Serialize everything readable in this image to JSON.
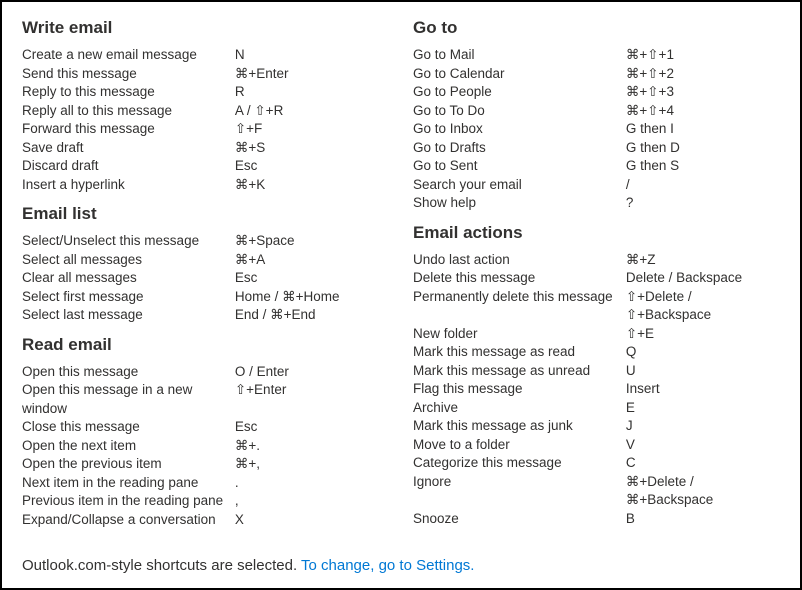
{
  "left": [
    {
      "title": "Write email",
      "rows": [
        {
          "desc": "Create a new email message",
          "key": "N"
        },
        {
          "desc": "Send this message",
          "key": "⌘+Enter"
        },
        {
          "desc": "Reply to this message",
          "key": "R"
        },
        {
          "desc": "Reply all to this message",
          "key": "A / ⇧+R"
        },
        {
          "desc": "Forward this message",
          "key": "⇧+F"
        },
        {
          "desc": "Save draft",
          "key": "⌘+S"
        },
        {
          "desc": "Discard draft",
          "key": "Esc"
        },
        {
          "desc": "Insert a hyperlink",
          "key": "⌘+K"
        }
      ]
    },
    {
      "title": "Email list",
      "rows": [
        {
          "desc": "Select/Unselect this message",
          "key": "⌘+Space"
        },
        {
          "desc": "Select all messages",
          "key": "⌘+A"
        },
        {
          "desc": "Clear all messages",
          "key": "Esc"
        },
        {
          "desc": "Select first message",
          "key": "Home / ⌘+Home"
        },
        {
          "desc": "Select last message",
          "key": "End / ⌘+End"
        }
      ]
    },
    {
      "title": "Read email",
      "rows": [
        {
          "desc": "Open this message",
          "key": "O / Enter"
        },
        {
          "desc": "Open this message in a new window",
          "key": "⇧+Enter"
        },
        {
          "desc": "Close this message",
          "key": "Esc"
        },
        {
          "desc": "Open the next item",
          "key": "⌘+."
        },
        {
          "desc": "Open the previous item",
          "key": "⌘+,"
        },
        {
          "desc": "Next item in the reading pane",
          "key": "."
        },
        {
          "desc": "Previous item in the reading pane",
          "key": ","
        },
        {
          "desc": "Expand/Collapse a conversation",
          "key": "X"
        }
      ]
    }
  ],
  "right": [
    {
      "title": "Go to",
      "rows": [
        {
          "desc": "Go to Mail",
          "key": "⌘+⇧+1"
        },
        {
          "desc": "Go to Calendar",
          "key": "⌘+⇧+2"
        },
        {
          "desc": "Go to People",
          "key": "⌘+⇧+3"
        },
        {
          "desc": "Go to To Do",
          "key": "⌘+⇧+4"
        },
        {
          "desc": "Go to Inbox",
          "key": "G then I"
        },
        {
          "desc": "Go to Drafts",
          "key": "G then D"
        },
        {
          "desc": "Go to Sent",
          "key": "G then S"
        },
        {
          "desc": "Search your email",
          "key": "/"
        },
        {
          "desc": "Show help",
          "key": "?"
        }
      ]
    },
    {
      "title": "Email actions",
      "rows": [
        {
          "desc": "Undo last action",
          "key": "⌘+Z"
        },
        {
          "desc": "Delete this message",
          "key": "Delete / Backspace"
        },
        {
          "desc": "Permanently delete this message",
          "key": "⇧+Delete / ⇧+Backspace"
        },
        {
          "desc": "New folder",
          "key": "⇧+E"
        },
        {
          "desc": "Mark this message as read",
          "key": "Q"
        },
        {
          "desc": "Mark this message as unread",
          "key": "U"
        },
        {
          "desc": "Flag this message",
          "key": "Insert"
        },
        {
          "desc": "Archive",
          "key": "E"
        },
        {
          "desc": "Mark this message as junk",
          "key": "J"
        },
        {
          "desc": "Move to a folder",
          "key": "V"
        },
        {
          "desc": "Categorize this message",
          "key": "C"
        },
        {
          "desc": "Ignore",
          "key": "⌘+Delete / ⌘+Backspace"
        },
        {
          "desc": "Snooze",
          "key": "B"
        }
      ]
    }
  ],
  "footer": {
    "text_before": "Outlook.com-style shortcuts are selected. ",
    "link_text": "To change, go to Settings."
  }
}
